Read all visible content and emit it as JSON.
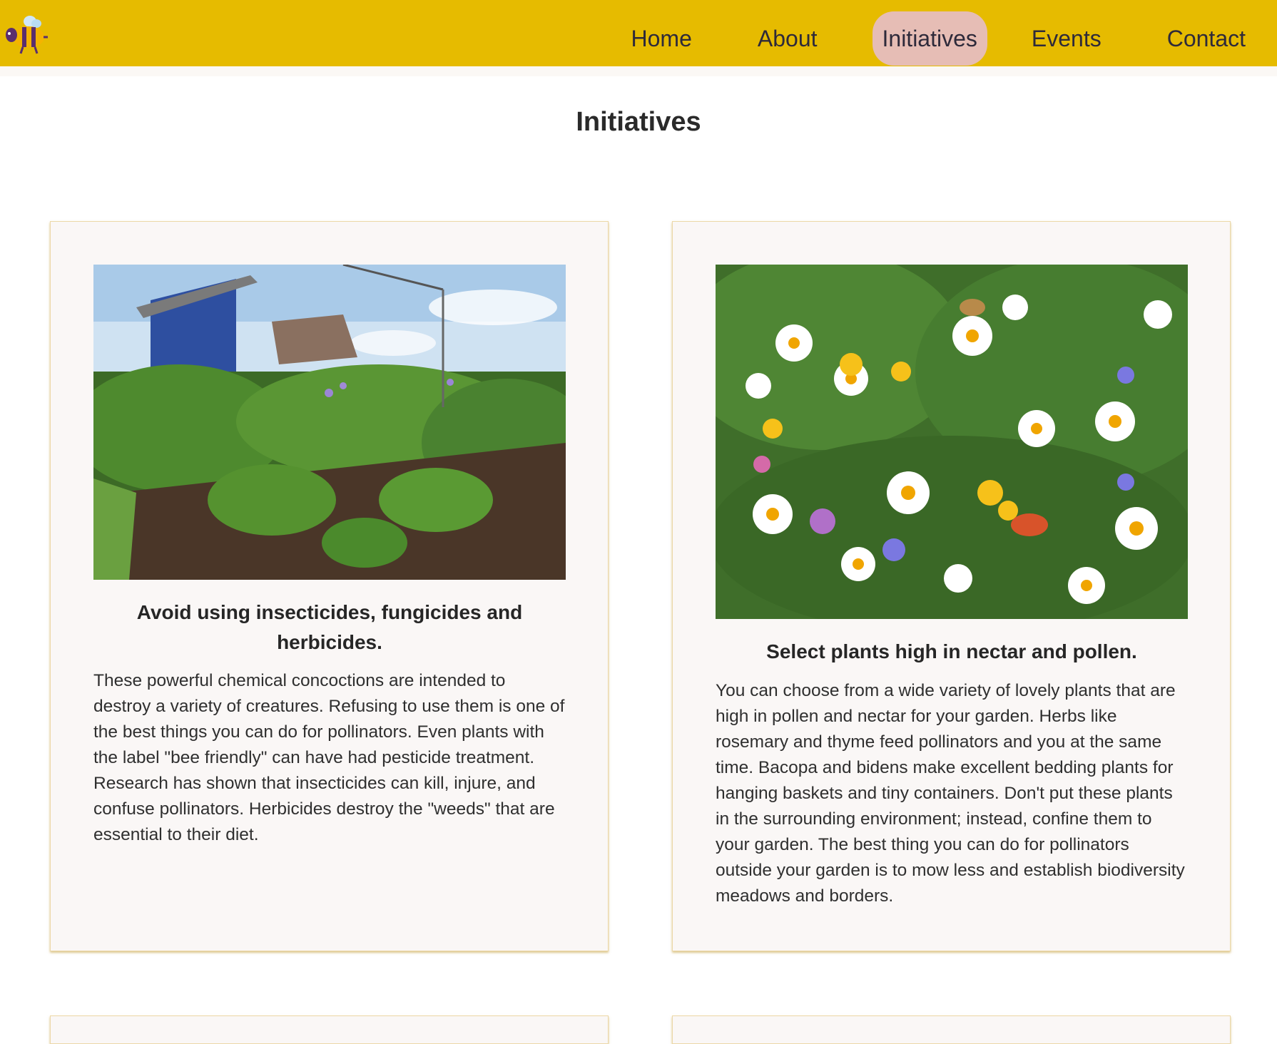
{
  "header": {
    "logo_icon": "bee-icon",
    "brand_color": "#e6bb00",
    "active_color": "#e6bdb5",
    "nav": [
      {
        "label": "Home",
        "active": false
      },
      {
        "label": "About",
        "active": false
      },
      {
        "label": "Initiatives",
        "active": true
      },
      {
        "label": "Events",
        "active": false
      },
      {
        "label": "Contact",
        "active": false
      }
    ]
  },
  "main": {
    "title": "Initiatives",
    "cards": [
      {
        "image": "allotment-garden-image",
        "heading": "Avoid using insecticides, fungicides and herbicides.",
        "body": "These powerful chemical concoctions are intended to destroy a variety of creatures. Refusing to use them is one of the best things you can do for pollinators. Even plants with the label \"bee friendly\" can have had pesticide treatment. Research has shown that insecticides can kill, injure, and confuse pollinators. Herbicides destroy the \"weeds\" that are essential to their diet."
      },
      {
        "image": "wildflower-meadow-image",
        "heading": "Select plants high in nectar and pollen.",
        "body": "You can choose from a wide variety of lovely plants that are high in pollen and nectar for your garden. Herbs like rosemary and thyme feed pollinators and you at the same time. Bacopa and bidens make excellent bedding plants for hanging baskets and tiny containers. Don't put these plants in the surrounding environment; instead, confine them to your garden. The best thing you can do for pollinators outside your garden is to mow less and establish biodiversity meadows and borders."
      }
    ]
  }
}
